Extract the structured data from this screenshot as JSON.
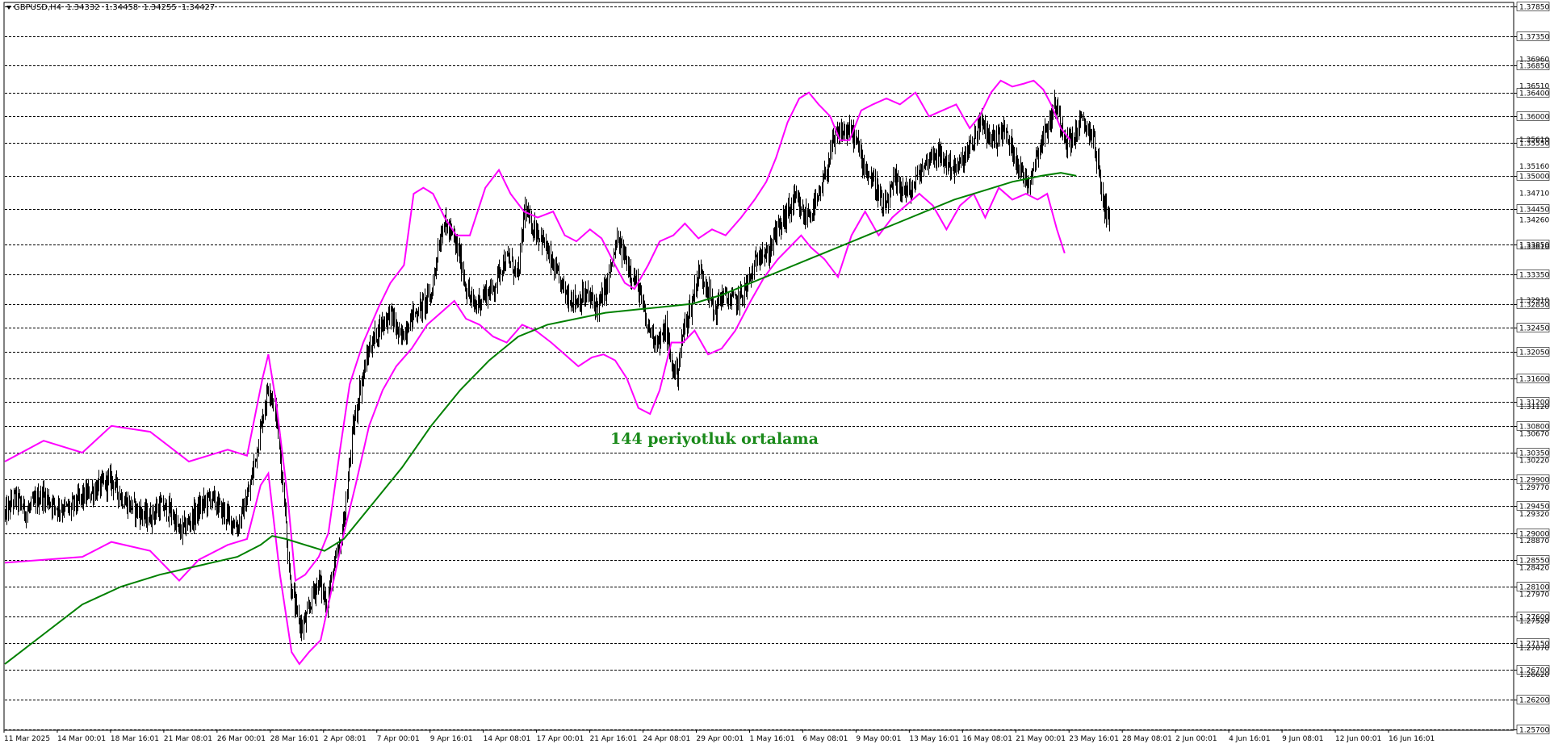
{
  "header": {
    "symbol": "GBPUSD,H4",
    "open": "1.34332",
    "high": "1.34458",
    "low": "1.34255",
    "close": "1.34427"
  },
  "annotation": "144 periyotluk ortalama",
  "colors": {
    "candles": "#000000",
    "bollinger": "#ff00ff",
    "moving_average": "#008000",
    "annotation": "#1a8a1a",
    "grid": "#000000",
    "background": "#ffffff"
  },
  "chart_data": {
    "type": "candlestick",
    "symbol": "GBPUSD",
    "timeframe": "H4",
    "ylim": [
      1.257,
      1.379
    ],
    "grid": "horizontal dashed at price levels",
    "price_grid_levels": [
      1.3785,
      1.3735,
      1.3685,
      1.364,
      1.36,
      1.3555,
      1.35,
      1.3445,
      1.3385,
      1.3335,
      1.3285,
      1.3245,
      1.3205,
      1.316,
      1.312,
      1.308,
      1.3035,
      1.299,
      1.2945,
      1.29,
      1.2855,
      1.281,
      1.276,
      1.2715,
      1.267,
      1.262,
      1.257
    ],
    "minor_price_labels": [
      "1.36960",
      "1.36510",
      "1.35610",
      "1.35160",
      "1.34710",
      "1.34260",
      "1.33810",
      "1.32910",
      "1.31120",
      "1.30670",
      "1.30220",
      "1.29770",
      "1.29320",
      "1.28870",
      "1.28420",
      "1.27970",
      "1.27520",
      "1.27070",
      "1.26620"
    ],
    "x_labels": [
      "11 Mar 2025",
      "14 Mar 00:01",
      "18 Mar 16:01",
      "21 Mar 08:01",
      "26 Mar 00:01",
      "28 Mar 16:01",
      "2 Apr 08:01",
      "7 Apr 00:01",
      "9 Apr 16:01",
      "14 Apr 08:01",
      "17 Apr 00:01",
      "21 Apr 16:01",
      "24 Apr 08:01",
      "29 Apr 00:01",
      "1 May 16:01",
      "6 May 08:01",
      "9 May 00:01",
      "13 May 16:01",
      "16 May 08:01",
      "21 May 00:01",
      "23 May 16:01",
      "28 May 08:01",
      "2 Jun 00:01",
      "4 Jun 16:01",
      "9 Jun 08:01",
      "12 Jun 00:01",
      "16 Jun 16:01"
    ],
    "price_path": [
      [
        0,
        1.293
      ],
      [
        10,
        1.296
      ],
      [
        22,
        1.2935
      ],
      [
        38,
        1.2965
      ],
      [
        52,
        1.2945
      ],
      [
        66,
        1.294
      ],
      [
        80,
        1.296
      ],
      [
        95,
        1.2975
      ],
      [
        110,
        1.299
      ],
      [
        122,
        1.2955
      ],
      [
        134,
        1.294
      ],
      [
        148,
        1.2925
      ],
      [
        160,
        1.2945
      ],
      [
        172,
        1.2935
      ],
      [
        180,
        1.29
      ],
      [
        188,
        1.2915
      ],
      [
        200,
        1.294
      ],
      [
        212,
        1.296
      ],
      [
        220,
        1.2945
      ],
      [
        228,
        1.293
      ],
      [
        240,
        1.291
      ],
      [
        252,
        1.297
      ],
      [
        262,
        1.306
      ],
      [
        272,
        1.315
      ],
      [
        280,
        1.31
      ],
      [
        288,
        1.296
      ],
      [
        294,
        1.282
      ],
      [
        300,
        1.277
      ],
      [
        306,
        1.274
      ],
      [
        312,
        1.276
      ],
      [
        318,
        1.28
      ],
      [
        324,
        1.282
      ],
      [
        332,
        1.278
      ],
      [
        338,
        1.283
      ],
      [
        346,
        1.288
      ],
      [
        352,
        1.295
      ],
      [
        358,
        1.306
      ],
      [
        366,
        1.314
      ],
      [
        376,
        1.321
      ],
      [
        388,
        1.325
      ],
      [
        398,
        1.327
      ],
      [
        408,
        1.3225
      ],
      [
        420,
        1.3265
      ],
      [
        430,
        1.328
      ],
      [
        440,
        1.33
      ],
      [
        446,
        1.337
      ],
      [
        452,
        1.342
      ],
      [
        458,
        1.341
      ],
      [
        464,
        1.339
      ],
      [
        470,
        1.336
      ],
      [
        476,
        1.331
      ],
      [
        484,
        1.328
      ],
      [
        494,
        1.33
      ],
      [
        504,
        1.331
      ],
      [
        512,
        1.335
      ],
      [
        520,
        1.336
      ],
      [
        530,
        1.333
      ],
      [
        536,
        1.3445
      ],
      [
        542,
        1.342
      ],
      [
        548,
        1.341
      ],
      [
        556,
        1.339
      ],
      [
        562,
        1.336
      ],
      [
        570,
        1.333
      ],
      [
        580,
        1.33
      ],
      [
        590,
        1.329
      ],
      [
        600,
        1.33
      ],
      [
        612,
        1.328
      ],
      [
        620,
        1.331
      ],
      [
        626,
        1.335
      ],
      [
        632,
        1.339
      ],
      [
        638,
        1.337
      ],
      [
        646,
        1.334
      ],
      [
        654,
        1.331
      ],
      [
        662,
        1.325
      ],
      [
        670,
        1.323
      ],
      [
        676,
        1.322
      ],
      [
        682,
        1.3245
      ],
      [
        688,
        1.318
      ],
      [
        694,
        1.317
      ],
      [
        700,
        1.324
      ],
      [
        708,
        1.328
      ],
      [
        716,
        1.334
      ],
      [
        724,
        1.332
      ],
      [
        732,
        1.327
      ],
      [
        740,
        1.33
      ],
      [
        748,
        1.329
      ],
      [
        756,
        1.329
      ],
      [
        764,
        1.331
      ],
      [
        772,
        1.334
      ],
      [
        780,
        1.338
      ],
      [
        786,
        1.336
      ],
      [
        794,
        1.34
      ],
      [
        800,
        1.3415
      ],
      [
        808,
        1.344
      ],
      [
        816,
        1.346
      ],
      [
        824,
        1.343
      ],
      [
        832,
        1.344
      ],
      [
        840,
        1.346
      ],
      [
        848,
        1.351
      ],
      [
        854,
        1.355
      ],
      [
        860,
        1.357
      ],
      [
        868,
        1.3575
      ],
      [
        876,
        1.357
      ],
      [
        884,
        1.353
      ],
      [
        892,
        1.35
      ],
      [
        900,
        1.348
      ],
      [
        906,
        1.344
      ],
      [
        912,
        1.346
      ],
      [
        918,
        1.349
      ],
      [
        926,
        1.348
      ],
      [
        934,
        1.347
      ],
      [
        942,
        1.35
      ],
      [
        950,
        1.352
      ],
      [
        958,
        1.354
      ],
      [
        966,
        1.353
      ],
      [
        974,
        1.352
      ],
      [
        982,
        1.351
      ],
      [
        990,
        1.353
      ],
      [
        998,
        1.355
      ],
      [
        1006,
        1.359
      ],
      [
        1014,
        1.357
      ],
      [
        1022,
        1.356
      ],
      [
        1030,
        1.358
      ],
      [
        1038,
        1.355
      ],
      [
        1044,
        1.353
      ],
      [
        1050,
        1.35
      ],
      [
        1056,
        1.349
      ],
      [
        1062,
        1.352
      ],
      [
        1070,
        1.356
      ],
      [
        1078,
        1.359
      ],
      [
        1084,
        1.362
      ],
      [
        1090,
        1.359
      ],
      [
        1096,
        1.356
      ],
      [
        1102,
        1.356
      ],
      [
        1110,
        1.359
      ],
      [
        1118,
        1.358
      ],
      [
        1124,
        1.356
      ],
      [
        1128,
        1.352
      ],
      [
        1134,
        1.345
      ],
      [
        1140,
        1.3435
      ]
    ],
    "bollinger_upper": [
      [
        0,
        1.302
      ],
      [
        40,
        1.3055
      ],
      [
        80,
        1.3035
      ],
      [
        110,
        1.308
      ],
      [
        150,
        1.307
      ],
      [
        190,
        1.302
      ],
      [
        230,
        1.304
      ],
      [
        250,
        1.303
      ],
      [
        266,
        1.316
      ],
      [
        272,
        1.32
      ],
      [
        280,
        1.312
      ],
      [
        292,
        1.296
      ],
      [
        300,
        1.282
      ],
      [
        310,
        1.283
      ],
      [
        324,
        1.286
      ],
      [
        334,
        1.29
      ],
      [
        346,
        1.304
      ],
      [
        356,
        1.315
      ],
      [
        370,
        1.322
      ],
      [
        386,
        1.328
      ],
      [
        398,
        1.332
      ],
      [
        412,
        1.335
      ],
      [
        422,
        1.347
      ],
      [
        432,
        1.348
      ],
      [
        442,
        1.347
      ],
      [
        454,
        1.343
      ],
      [
        466,
        1.34
      ],
      [
        480,
        1.34
      ],
      [
        496,
        1.348
      ],
      [
        510,
        1.351
      ],
      [
        522,
        1.347
      ],
      [
        536,
        1.344
      ],
      [
        550,
        1.343
      ],
      [
        566,
        1.344
      ],
      [
        578,
        1.34
      ],
      [
        590,
        1.339
      ],
      [
        604,
        1.341
      ],
      [
        616,
        1.3395
      ],
      [
        630,
        1.335
      ],
      [
        640,
        1.332
      ],
      [
        650,
        1.331
      ],
      [
        664,
        1.335
      ],
      [
        676,
        1.339
      ],
      [
        690,
        1.34
      ],
      [
        702,
        1.342
      ],
      [
        716,
        1.3395
      ],
      [
        730,
        1.341
      ],
      [
        744,
        1.34
      ],
      [
        760,
        1.343
      ],
      [
        774,
        1.346
      ],
      [
        786,
        1.349
      ],
      [
        796,
        1.353
      ],
      [
        808,
        1.359
      ],
      [
        820,
        1.363
      ],
      [
        830,
        1.364
      ],
      [
        840,
        1.362
      ],
      [
        852,
        1.36
      ],
      [
        862,
        1.356
      ],
      [
        872,
        1.356
      ],
      [
        884,
        1.361
      ],
      [
        896,
        1.362
      ],
      [
        910,
        1.363
      ],
      [
        924,
        1.362
      ],
      [
        940,
        1.364
      ],
      [
        954,
        1.36
      ],
      [
        968,
        1.361
      ],
      [
        982,
        1.362
      ],
      [
        996,
        1.358
      ],
      [
        1006,
        1.36
      ],
      [
        1018,
        1.364
      ],
      [
        1028,
        1.366
      ],
      [
        1040,
        1.365
      ],
      [
        1052,
        1.3655
      ],
      [
        1062,
        1.366
      ],
      [
        1072,
        1.3645
      ],
      [
        1080,
        1.362
      ],
      [
        1090,
        1.358
      ],
      [
        1100,
        1.356
      ]
    ],
    "bollinger_lower": [
      [
        0,
        1.285
      ],
      [
        40,
        1.2855
      ],
      [
        80,
        1.286
      ],
      [
        110,
        1.2885
      ],
      [
        150,
        1.287
      ],
      [
        180,
        1.282
      ],
      [
        200,
        1.2855
      ],
      [
        230,
        1.288
      ],
      [
        250,
        1.289
      ],
      [
        264,
        1.298
      ],
      [
        272,
        1.3
      ],
      [
        284,
        1.283
      ],
      [
        296,
        1.27
      ],
      [
        304,
        1.268
      ],
      [
        314,
        1.27
      ],
      [
        326,
        1.272
      ],
      [
        338,
        1.281
      ],
      [
        350,
        1.29
      ],
      [
        362,
        1.298
      ],
      [
        376,
        1.308
      ],
      [
        390,
        1.314
      ],
      [
        404,
        1.318
      ],
      [
        420,
        1.321
      ],
      [
        436,
        1.325
      ],
      [
        450,
        1.327
      ],
      [
        464,
        1.329
      ],
      [
        476,
        1.326
      ],
      [
        490,
        1.325
      ],
      [
        504,
        1.323
      ],
      [
        518,
        1.322
      ],
      [
        534,
        1.325
      ],
      [
        548,
        1.324
      ],
      [
        564,
        1.322
      ],
      [
        578,
        1.32
      ],
      [
        592,
        1.318
      ],
      [
        606,
        1.3195
      ],
      [
        618,
        1.32
      ],
      [
        630,
        1.319
      ],
      [
        642,
        1.316
      ],
      [
        654,
        1.311
      ],
      [
        666,
        1.31
      ],
      [
        676,
        1.314
      ],
      [
        688,
        1.322
      ],
      [
        700,
        1.322
      ],
      [
        712,
        1.324
      ],
      [
        726,
        1.32
      ],
      [
        740,
        1.321
      ],
      [
        754,
        1.324
      ],
      [
        770,
        1.329
      ],
      [
        784,
        1.333
      ],
      [
        798,
        1.336
      ],
      [
        810,
        1.338
      ],
      [
        822,
        1.34
      ],
      [
        832,
        1.338
      ],
      [
        846,
        1.336
      ],
      [
        860,
        1.333
      ],
      [
        874,
        1.34
      ],
      [
        888,
        1.344
      ],
      [
        902,
        1.34
      ],
      [
        916,
        1.343
      ],
      [
        930,
        1.345
      ],
      [
        944,
        1.347
      ],
      [
        958,
        1.345
      ],
      [
        972,
        1.341
      ],
      [
        986,
        1.345
      ],
      [
        1000,
        1.347
      ],
      [
        1012,
        1.343
      ],
      [
        1026,
        1.348
      ],
      [
        1040,
        1.346
      ],
      [
        1054,
        1.347
      ],
      [
        1066,
        1.346
      ],
      [
        1076,
        1.347
      ],
      [
        1086,
        1.341
      ],
      [
        1094,
        1.337
      ]
    ],
    "moving_average_144": [
      [
        0,
        1.268
      ],
      [
        40,
        1.273
      ],
      [
        80,
        1.278
      ],
      [
        120,
        1.281
      ],
      [
        160,
        1.283
      ],
      [
        200,
        1.2845
      ],
      [
        240,
        1.286
      ],
      [
        264,
        1.288
      ],
      [
        276,
        1.2895
      ],
      [
        290,
        1.289
      ],
      [
        310,
        1.288
      ],
      [
        330,
        1.287
      ],
      [
        350,
        1.289
      ],
      [
        380,
        1.295
      ],
      [
        410,
        1.301
      ],
      [
        440,
        1.308
      ],
      [
        470,
        1.314
      ],
      [
        500,
        1.319
      ],
      [
        530,
        1.323
      ],
      [
        560,
        1.325
      ],
      [
        590,
        1.326
      ],
      [
        620,
        1.327
      ],
      [
        650,
        1.3275
      ],
      [
        680,
        1.328
      ],
      [
        710,
        1.3285
      ],
      [
        740,
        1.33
      ],
      [
        770,
        1.332
      ],
      [
        800,
        1.334
      ],
      [
        830,
        1.336
      ],
      [
        860,
        1.338
      ],
      [
        890,
        1.34
      ],
      [
        920,
        1.342
      ],
      [
        950,
        1.344
      ],
      [
        980,
        1.346
      ],
      [
        1010,
        1.3475
      ],
      [
        1040,
        1.349
      ],
      [
        1070,
        1.35
      ],
      [
        1090,
        1.3505
      ],
      [
        1106,
        1.35
      ]
    ]
  }
}
